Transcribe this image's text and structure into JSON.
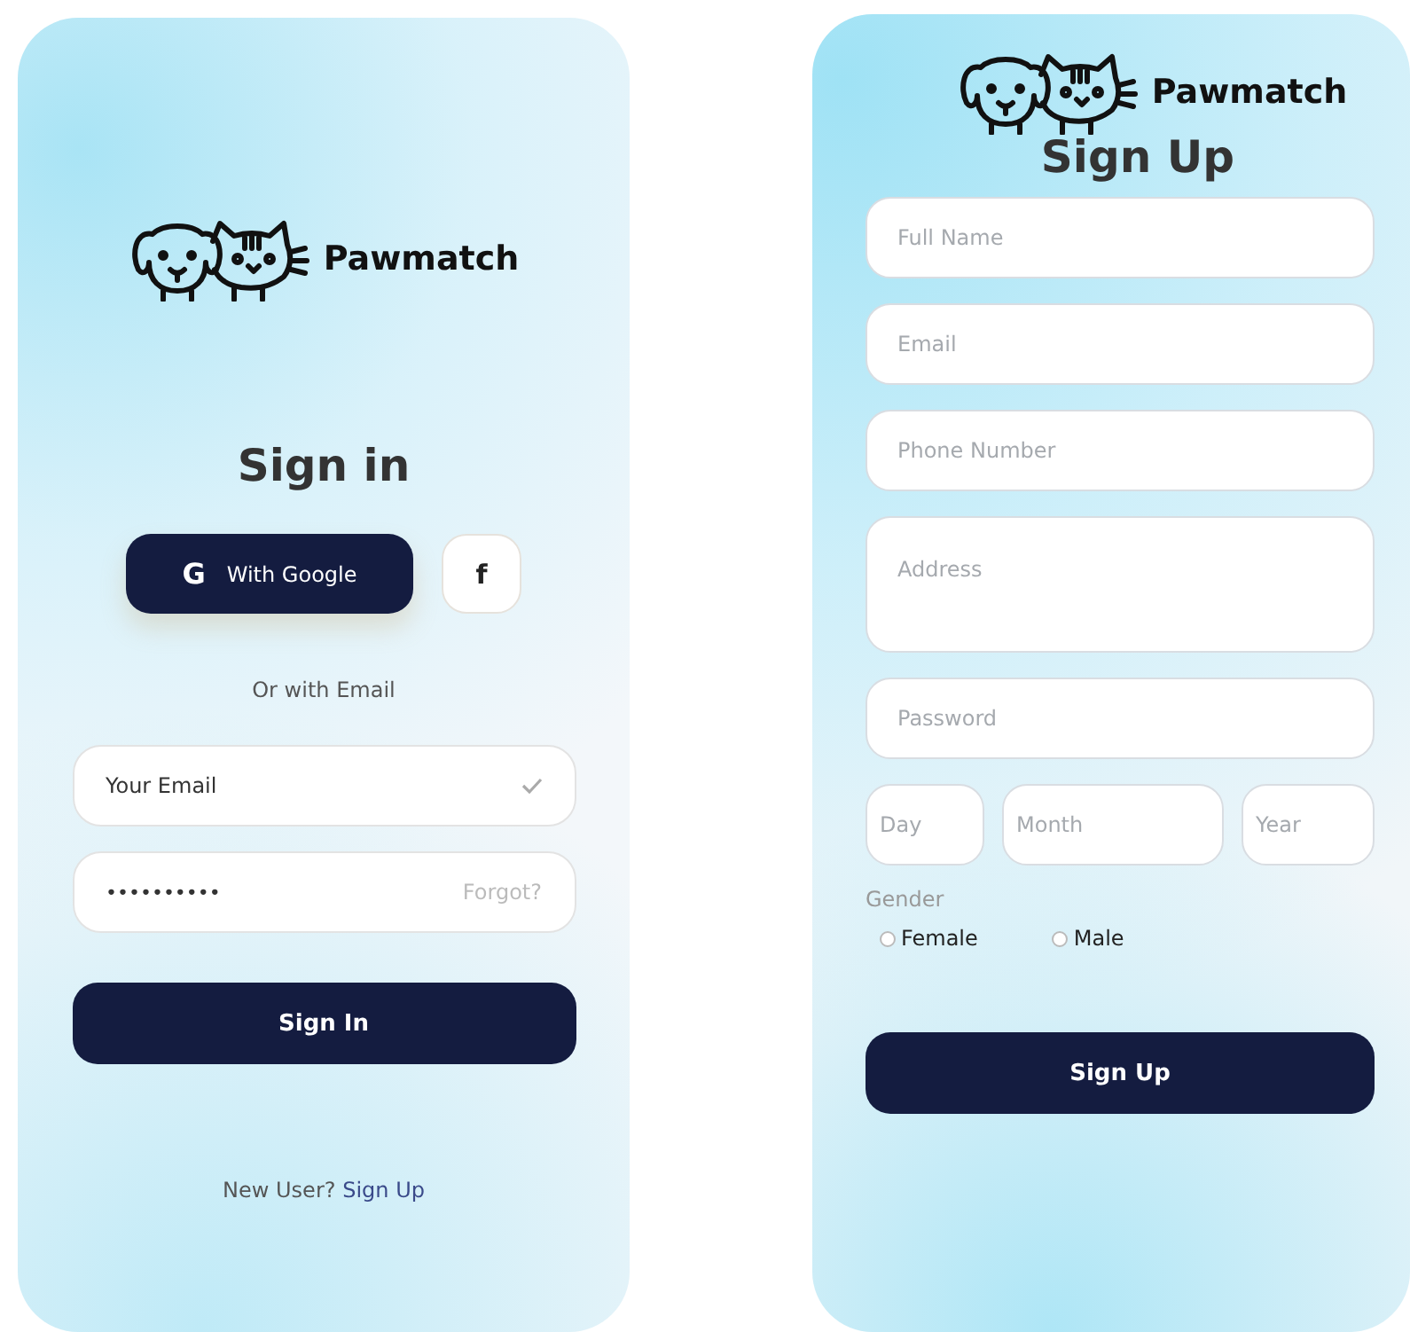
{
  "signin": {
    "brand": "Pawmatch",
    "title": "Sign in",
    "google_button": {
      "icon": "G",
      "label": "With Google"
    },
    "facebook_button": {
      "icon": "f"
    },
    "divider_text": "Or with Email",
    "email": {
      "value": "Your Email",
      "valid": true
    },
    "password": {
      "value": "••••••••••",
      "link": "Forgot?"
    },
    "submit": "Sign In",
    "footer": {
      "text": "New User?",
      "link": "Sign Up"
    }
  },
  "signup": {
    "brand": "Pawmatch",
    "title": "Sign Up",
    "fields": [
      {
        "placeholder": "Full Name",
        "kind": "line"
      },
      {
        "placeholder": "Email",
        "kind": "line"
      },
      {
        "placeholder": "Phone Number",
        "kind": "line"
      },
      {
        "placeholder": "Address",
        "kind": "area"
      },
      {
        "placeholder": "Password",
        "kind": "line"
      }
    ],
    "date_fields": [
      {
        "placeholder": "Day"
      },
      {
        "placeholder": "Month"
      },
      {
        "placeholder": "Year"
      }
    ],
    "gender": {
      "label": "Gender",
      "options": [
        {
          "label": "Female",
          "selected": false
        },
        {
          "label": "Male",
          "selected": false
        }
      ]
    },
    "submit": "Sign Up"
  }
}
